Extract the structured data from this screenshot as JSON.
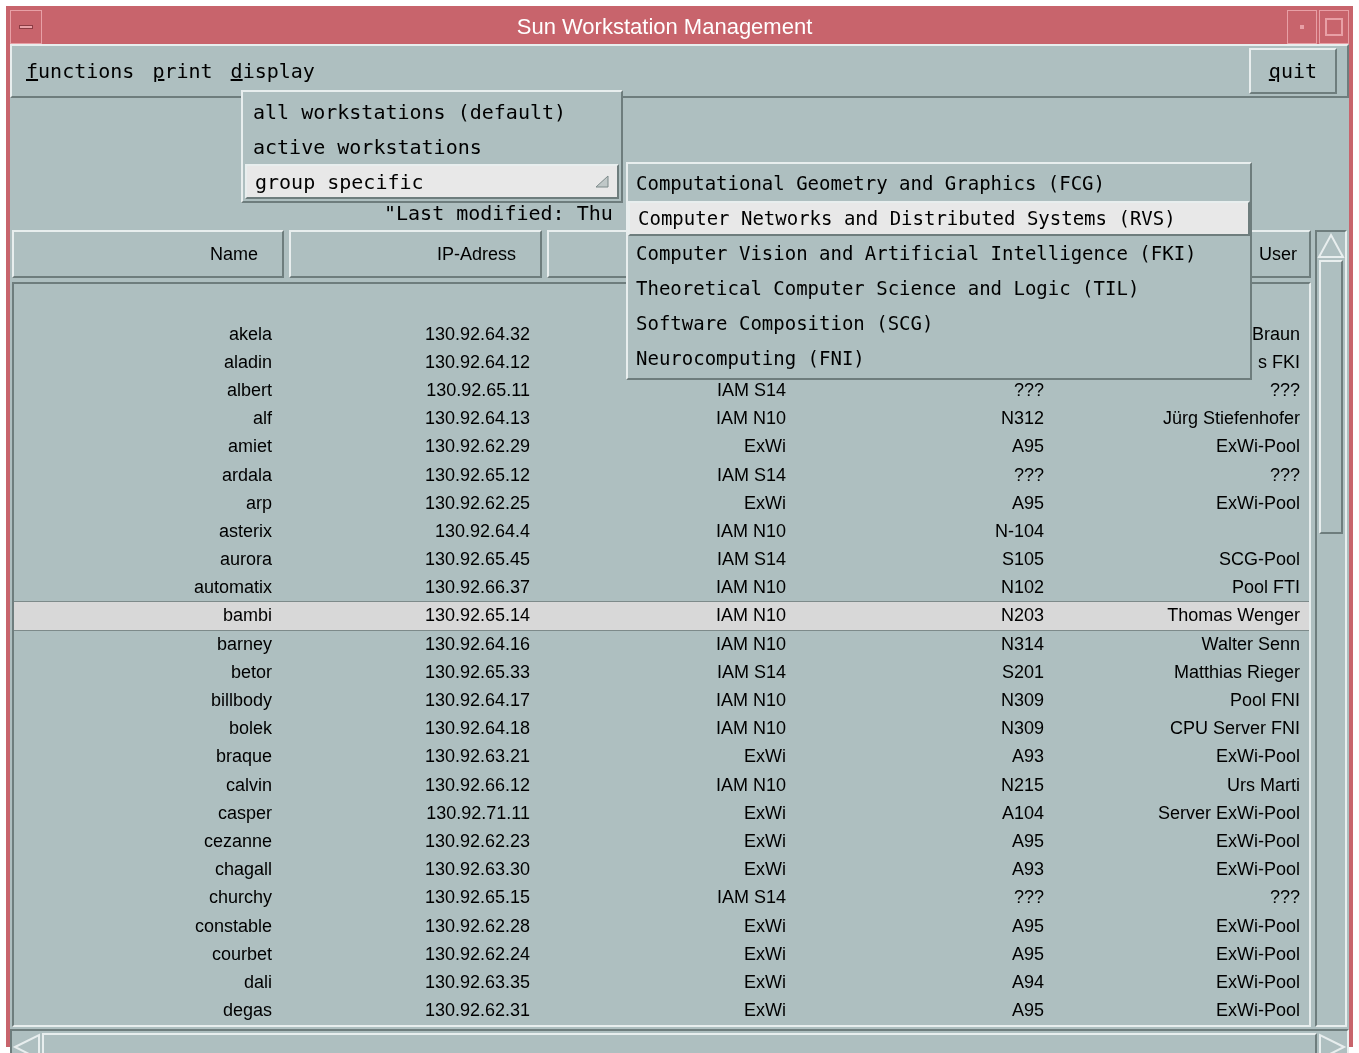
{
  "window": {
    "title": "Sun Workstation Management"
  },
  "menubar": {
    "items": [
      {
        "label": "functions"
      },
      {
        "label": "print"
      },
      {
        "label": "display"
      }
    ],
    "quit": "quit"
  },
  "display_menu": [
    {
      "label": "all workstations (default)",
      "kind": "item",
      "selected": false
    },
    {
      "label": "active workstations",
      "kind": "item",
      "selected": false
    },
    {
      "label": "group specific",
      "kind": "submenu",
      "selected": true
    }
  ],
  "group_menu": [
    {
      "label": "Computational Geometry and Graphics (FCG)",
      "selected": false
    },
    {
      "label": "Computer Networks and Distributed Systems (RVS)",
      "selected": true
    },
    {
      "label": "Computer Vision and Artificial Intelligence (FKI)",
      "selected": false
    },
    {
      "label": "Theoretical Computer Science and Logic (TIL)",
      "selected": false
    },
    {
      "label": "Software Composition (SCG)",
      "selected": false
    },
    {
      "label": "Neurocomputing (FNI)",
      "selected": false
    }
  ],
  "last_modified": "\"Last modified: Thu",
  "table": {
    "headers": {
      "name": "Name",
      "ip": "IP-Adress",
      "user": "User"
    },
    "rows": [
      {
        "name": "akela",
        "ip": "130.92.64.32",
        "user": "Braun",
        "selected": false
      },
      {
        "name": "aladin",
        "ip": "130.92.64.12",
        "user": "s FKI",
        "selected": false
      },
      {
        "name": "albert",
        "ip": "130.92.65.11",
        "building": "IAM S14",
        "room": "???",
        "user": "???",
        "selected": false
      },
      {
        "name": "alf",
        "ip": "130.92.64.13",
        "building": "IAM N10",
        "room": "N312",
        "user": "Jürg Stiefenhofer",
        "selected": false
      },
      {
        "name": "amiet",
        "ip": "130.92.62.29",
        "building": "ExWi",
        "room": "A95",
        "user": "ExWi-Pool",
        "selected": false
      },
      {
        "name": "ardala",
        "ip": "130.92.65.12",
        "building": "IAM S14",
        "room": "???",
        "user": "???",
        "selected": false
      },
      {
        "name": "arp",
        "ip": "130.92.62.25",
        "building": "ExWi",
        "room": "A95",
        "user": "ExWi-Pool",
        "selected": false
      },
      {
        "name": "asterix",
        "ip": "130.92.64.4",
        "building": "IAM N10",
        "room": "N-104",
        "selected": false
      },
      {
        "name": "aurora",
        "ip": "130.92.65.45",
        "building": "IAM S14",
        "room": "S105",
        "user": "SCG-Pool",
        "selected": false
      },
      {
        "name": "automatix",
        "ip": "130.92.66.37",
        "building": "IAM N10",
        "room": "N102",
        "user": "Pool FTI",
        "selected": false
      },
      {
        "name": "bambi",
        "ip": "130.92.65.14",
        "building": "IAM N10",
        "room": "N203",
        "user": "Thomas Wenger",
        "selected": true
      },
      {
        "name": "barney",
        "ip": "130.92.64.16",
        "building": "IAM N10",
        "room": "N314",
        "user": "Walter Senn",
        "selected": false
      },
      {
        "name": "betor",
        "ip": "130.92.65.33",
        "building": "IAM S14",
        "room": "S201",
        "user": "Matthias Rieger",
        "selected": false
      },
      {
        "name": "billbody",
        "ip": "130.92.64.17",
        "building": "IAM N10",
        "room": "N309",
        "user": "Pool FNI",
        "selected": false
      },
      {
        "name": "bolek",
        "ip": "130.92.64.18",
        "building": "IAM N10",
        "room": "N309",
        "user": "CPU Server FNI",
        "selected": false
      },
      {
        "name": "braque",
        "ip": "130.92.63.21",
        "building": "ExWi",
        "room": "A93",
        "user": "ExWi-Pool",
        "selected": false
      },
      {
        "name": "calvin",
        "ip": "130.92.66.12",
        "building": "IAM N10",
        "room": "N215",
        "user": "Urs Marti",
        "selected": false
      },
      {
        "name": "casper",
        "ip": "130.92.71.11",
        "building": "ExWi",
        "room": "A104",
        "user": "Server ExWi-Pool",
        "selected": false
      },
      {
        "name": "cezanne",
        "ip": "130.92.62.23",
        "building": "ExWi",
        "room": "A95",
        "user": "ExWi-Pool",
        "selected": false
      },
      {
        "name": "chagall",
        "ip": "130.92.63.30",
        "building": "ExWi",
        "room": "A93",
        "user": "ExWi-Pool",
        "selected": false
      },
      {
        "name": "churchy",
        "ip": "130.92.65.15",
        "building": "IAM S14",
        "room": "???",
        "user": "???",
        "selected": false
      },
      {
        "name": "constable",
        "ip": "130.92.62.28",
        "building": "ExWi",
        "room": "A95",
        "user": "ExWi-Pool",
        "selected": false
      },
      {
        "name": "courbet",
        "ip": "130.92.62.24",
        "building": "ExWi",
        "room": "A95",
        "user": "ExWi-Pool",
        "selected": false
      },
      {
        "name": "dali",
        "ip": "130.92.63.35",
        "building": "ExWi",
        "room": "A94",
        "user": "ExWi-Pool",
        "selected": false
      },
      {
        "name": "degas",
        "ip": "130.92.62.31",
        "building": "ExWi",
        "room": "A95",
        "user": "ExWi-Pool",
        "selected": false
      }
    ]
  }
}
